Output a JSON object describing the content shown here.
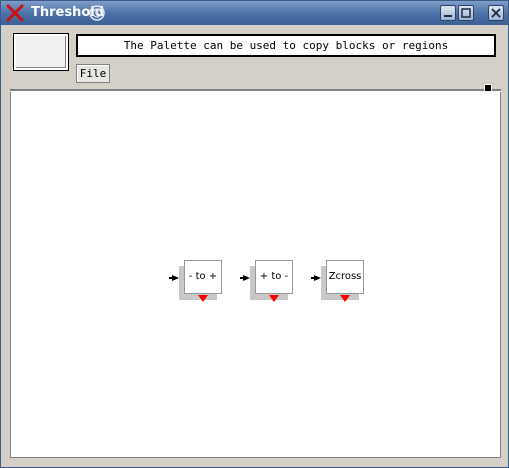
{
  "window": {
    "title": "Threshold"
  },
  "toolbar": {
    "message": "The Palette can be used to copy blocks or regions",
    "file_label": "File"
  },
  "blocks": [
    {
      "label": "- to +"
    },
    {
      "label": "+ to -"
    },
    {
      "label": "Zcross"
    }
  ],
  "colors": {
    "titlebar": "#4e73a8",
    "output_port": "#ff0000"
  },
  "icons": {
    "close": "x-icon",
    "logo": "swirl-icon",
    "minimize": "minimize-icon",
    "maximize": "maximize-icon",
    "close_button": "close-icon"
  }
}
